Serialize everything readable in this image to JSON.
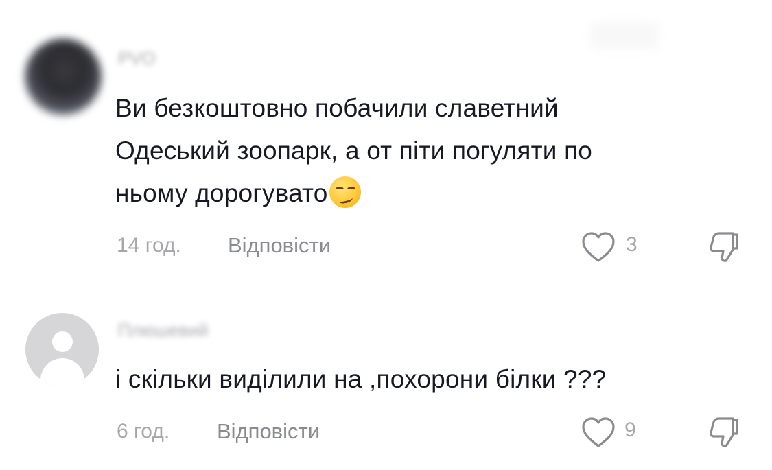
{
  "comments": [
    {
      "username": "РVО",
      "text_lines": [
        "Ви безкоштовно побачили славетний",
        "Одеський зоопарк, а от піти погуляти по",
        "ньому дорогувато"
      ],
      "emoji": "smirking-face",
      "time": "14 год.",
      "reply_label": "Відповісти",
      "likes": "3"
    },
    {
      "username": "Плюшевий",
      "text_lines": [
        "і скільки виділили на ,похорони білки ???"
      ],
      "time": "6 год.",
      "reply_label": "Відповісти",
      "likes": "9"
    }
  ],
  "icons": {
    "like": "heart-outline-icon",
    "dislike": "thumbs-down-outline-icon"
  },
  "colors": {
    "text": "#161823",
    "meta": "#a6a7ac",
    "reply": "#8a8b91",
    "avatar_default": "#d6d6d8"
  }
}
